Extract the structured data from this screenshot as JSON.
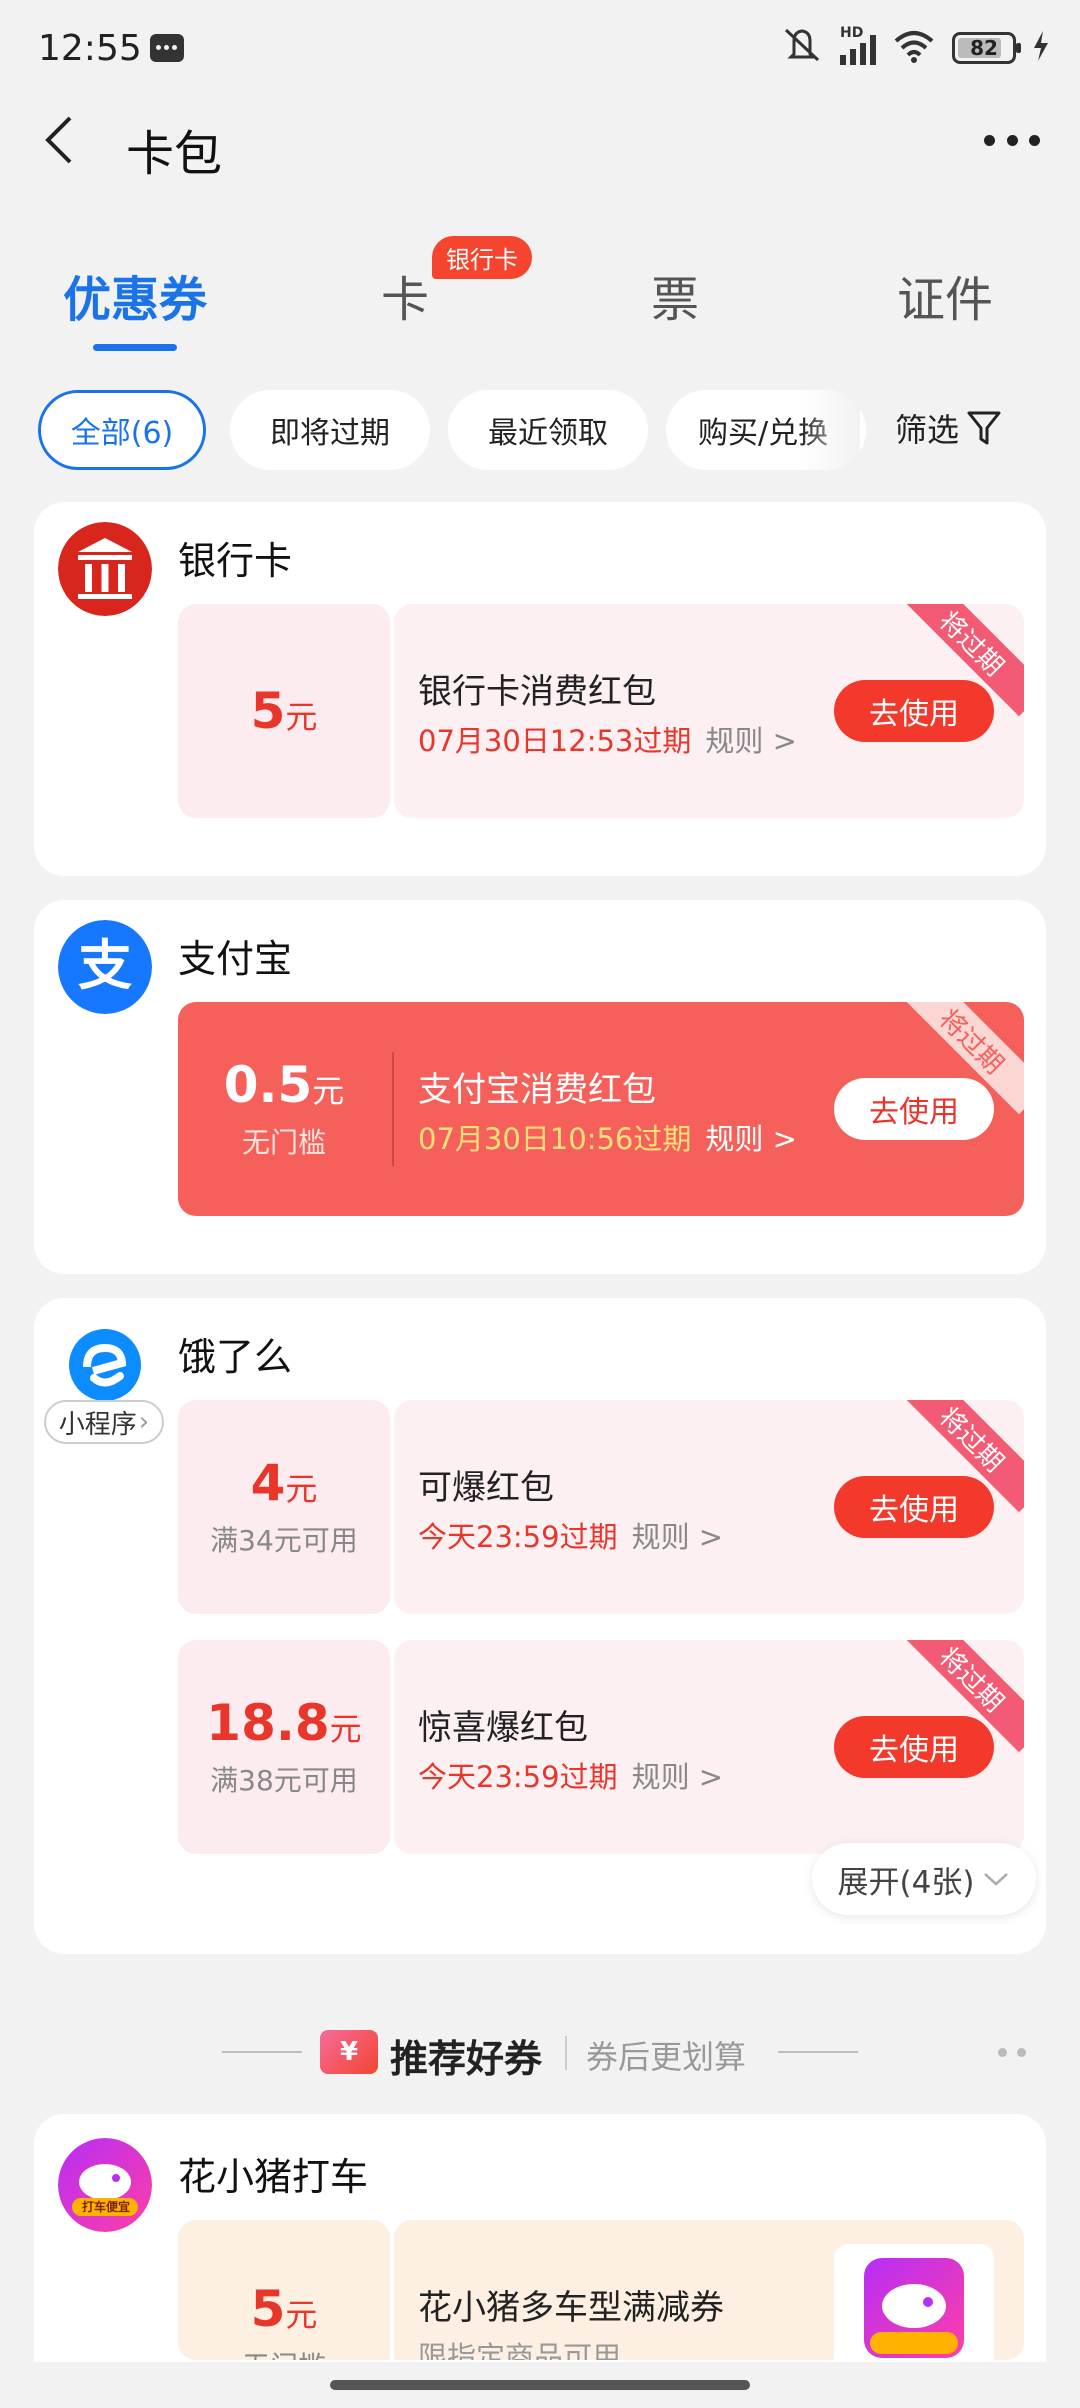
{
  "status": {
    "time": "12:55",
    "network": "HD",
    "battery": "82",
    "battery_level": 0.82
  },
  "header": {
    "title": "卡包"
  },
  "tabs": [
    {
      "label": "优惠券"
    },
    {
      "label": "卡"
    },
    {
      "label": "票"
    },
    {
      "label": "证件"
    }
  ],
  "tab_badge": "银行卡",
  "filters": [
    {
      "label": "全部(6)"
    },
    {
      "label": "即将过期"
    },
    {
      "label": "最近领取"
    },
    {
      "label": "购买/兑换"
    }
  ],
  "filter_button": "筛选",
  "cards": [
    {
      "merchant": "银行卡",
      "coupons": [
        {
          "amount": "5",
          "unit": "元",
          "condition": "",
          "title": "银行卡消费红包",
          "expire": "07月30日12:53过期",
          "rule": "规则 >",
          "action": "去使用",
          "tag": "将过期"
        }
      ]
    },
    {
      "merchant": "支付宝",
      "coupons": [
        {
          "amount": "0.5",
          "unit": "元",
          "condition": "无门槛",
          "title": "支付宝消费红包",
          "expire": "07月30日10:56过期",
          "rule": "规则 >",
          "action": "去使用",
          "tag": "将过期"
        }
      ]
    },
    {
      "merchant": "饿了么",
      "mini_program": "小程序",
      "coupons": [
        {
          "amount": "4",
          "unit": "元",
          "condition": "满34元可用",
          "title": "可爆红包",
          "expire": "今天23:59过期",
          "rule": "规则 >",
          "action": "去使用",
          "tag": "将过期"
        },
        {
          "amount": "18.8",
          "unit": "元",
          "condition": "满38元可用",
          "title": "惊喜爆红包",
          "expire": "今天23:59过期",
          "rule": "规则 >",
          "action": "去使用",
          "tag": "将过期"
        }
      ],
      "expand": "展开(4张)"
    }
  ],
  "recommend": {
    "icon_text": "¥",
    "title": "推荐好券",
    "subtitle": "券后更划算",
    "merchant": "花小猪打车",
    "logo_text": "打车便宜",
    "coupon": {
      "amount": "5",
      "unit": "元",
      "condition": "无门槛",
      "title": "花小猪多车型满减券",
      "desc": "限指定商品可用"
    }
  },
  "colors": {
    "accent": "#1a73e8",
    "red": "#e8362b",
    "coupon_bg": "#fdf0f2"
  }
}
